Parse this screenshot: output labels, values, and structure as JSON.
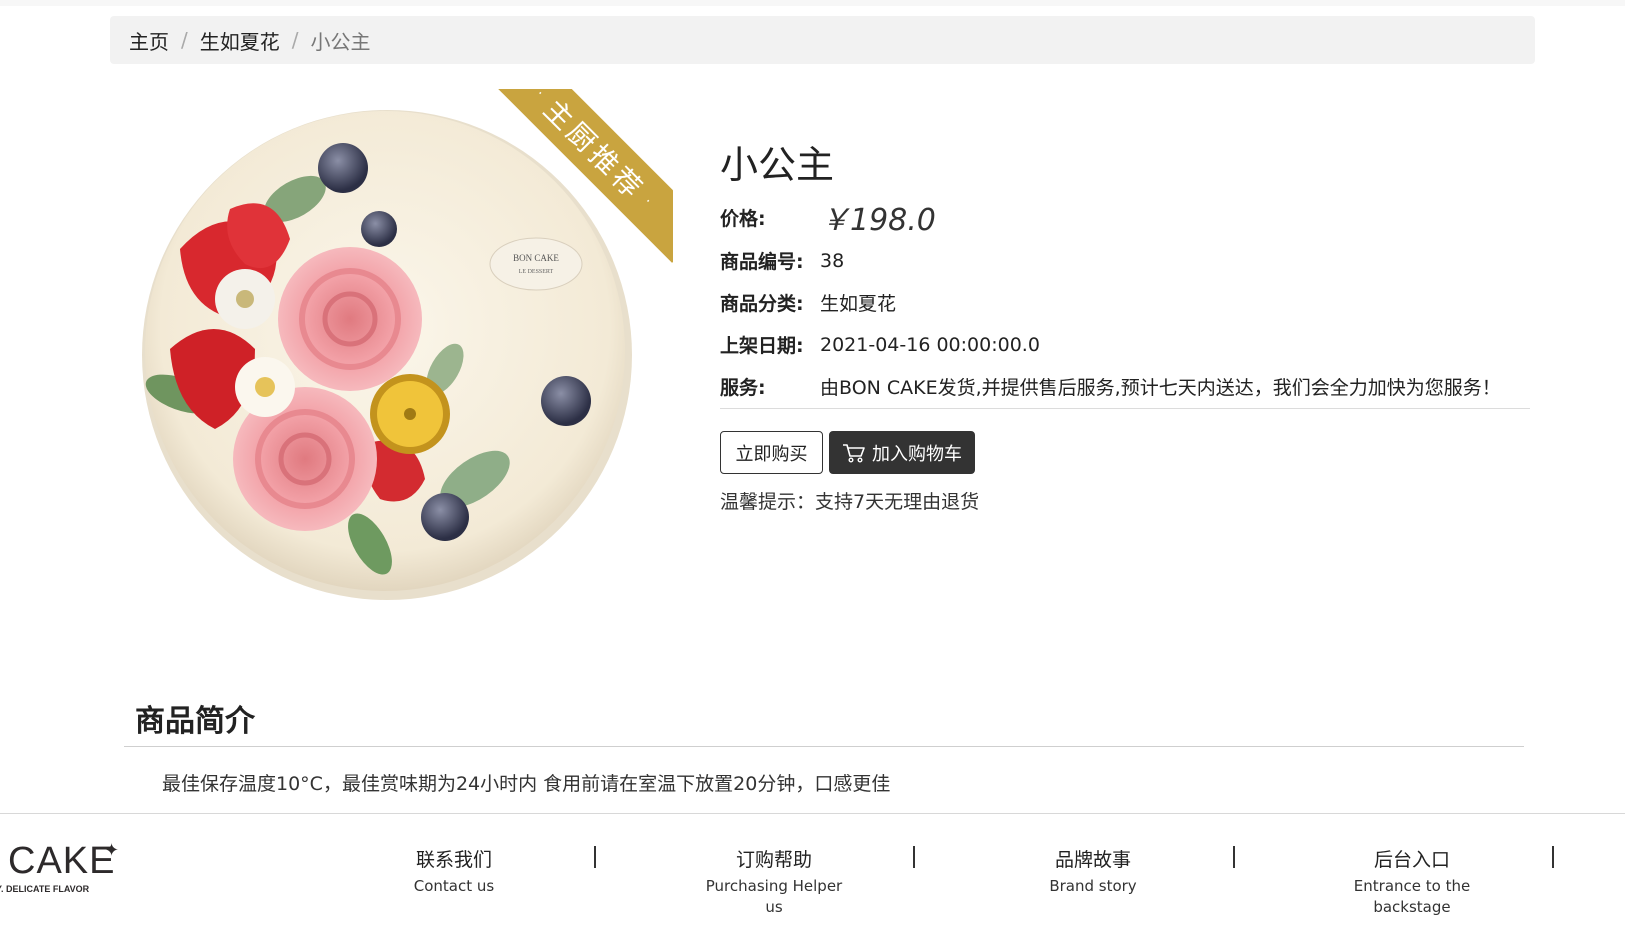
{
  "breadcrumb": {
    "home": "主页",
    "category": "生如夏花",
    "current": "小公主",
    "separator": "/"
  },
  "product": {
    "ribbon_text": "主厨推荐",
    "ribbon_dot": "·",
    "plaque_line1": "BON CAKE",
    "plaque_line2": "LE DESSERT",
    "title": "小公主",
    "price_label": "价格:",
    "price": "￥198.0",
    "id_label": "商品编号:",
    "id": "38",
    "category_label": "商品分类:",
    "category": "生如夏花",
    "date_label": "上架日期:",
    "date": "2021-04-16 00:00:00.0",
    "service_label": "服务:",
    "service": "由BON CAKE发货,并提供售后服务,预计七天内送达，我们会全力加快为您服务！",
    "buy_button": "立即购买",
    "cart_button": "加入购物车",
    "cart_icon": "shopping-cart-icon",
    "tip": "温馨提示：支持7天无理由退货"
  },
  "intro": {
    "title": "商品简介",
    "text": "最佳保存温度10°C，最佳赏味期为24小时内 食用前请在室温下放置20分钟，口感更佳"
  },
  "footer": {
    "logo_text": "CAKE",
    "logo_sub": "Y. DELICATE FLAVOR",
    "links": [
      {
        "cn": "联系我们",
        "en": "Contact us"
      },
      {
        "cn": "订购帮助",
        "en": "Purchasing Helper us"
      },
      {
        "cn": "品牌故事",
        "en": "Brand story"
      },
      {
        "cn": "后台入口",
        "en": "Entrance to the backstage"
      }
    ]
  },
  "colors": {
    "ribbon": "#c9a43f",
    "cart_button_bg": "#333333",
    "breadcrumb_bg": "#f2f2f2"
  }
}
